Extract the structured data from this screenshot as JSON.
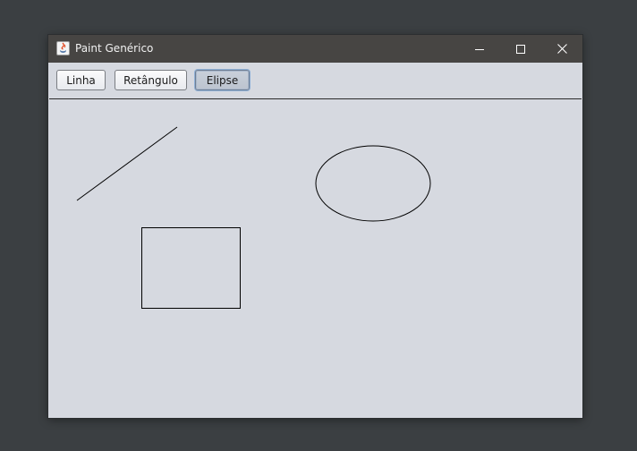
{
  "window": {
    "title": "Paint Genérico",
    "controls": {
      "minimize": "minimize-icon",
      "maximize": "maximize-icon",
      "close": "close-icon"
    }
  },
  "toolbar": {
    "buttons": [
      {
        "label": "Linha",
        "selected": false
      },
      {
        "label": "Retângulo",
        "selected": false
      },
      {
        "label": "Elipse",
        "selected": true
      }
    ]
  },
  "canvas": {
    "stroke_color": "#000000",
    "shapes": [
      "line",
      "rectangle",
      "ellipse"
    ]
  },
  "colors": {
    "titlebar": "#474543",
    "background": "#d6d9e0",
    "desktop": "#3b3f42"
  }
}
